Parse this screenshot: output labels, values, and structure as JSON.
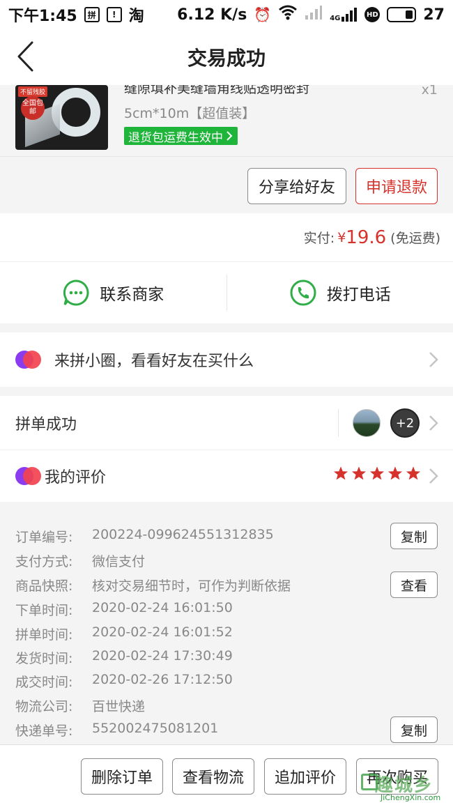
{
  "status_bar": {
    "time": "下午1:45",
    "icon_pdd": "拼",
    "icon_taobao": "淘",
    "net_speed": "6.12 K/s",
    "net_4g": "4G",
    "battery": "27"
  },
  "nav": {
    "title": "交易成功"
  },
  "product": {
    "title": "缝隙填补美缝墙角线贴透明密封",
    "quantity": "x1",
    "spec": "5cm*10m【超值装】",
    "policy_tag": "退货包运费生效中",
    "thumb_tag": "不留残胶",
    "thumb_badge": "全国包邮"
  },
  "actions": {
    "share_label": "分享给好友",
    "refund_label": "申请退款"
  },
  "payment": {
    "label": "实付:",
    "currency": "¥",
    "amount": "19.6",
    "note": "(免运费)"
  },
  "contact": {
    "merchant_label": "联系商家",
    "phone_label": "拨打电话"
  },
  "circle": {
    "text": "来拼小圈，看看好友在买什么"
  },
  "group": {
    "label": "拼单成功",
    "extra_count": "+2"
  },
  "review": {
    "label": "我的评价",
    "rating": 5,
    "max": 5
  },
  "details": {
    "order_no": {
      "key": "订单编号:",
      "value": "200224-099624551312835",
      "copy_label": "复制"
    },
    "pay_method": {
      "key": "支付方式:",
      "value": "微信支付"
    },
    "snapshot": {
      "key": "商品快照:",
      "value": "核对交易细节时，可作为判断依据",
      "view_label": "查看"
    },
    "order_time": {
      "key": "下单时间:",
      "value": "2020-02-24 16:01:50"
    },
    "group_time": {
      "key": "拼单时间:",
      "value": "2020-02-24 16:01:52"
    },
    "ship_time": {
      "key": "发货时间:",
      "value": "2020-02-24 17:30:49"
    },
    "deal_time": {
      "key": "成交时间:",
      "value": "2020-02-26 17:12:50"
    },
    "courier": {
      "key": "物流公司:",
      "value": "百世快递"
    },
    "tracking": {
      "key": "快递单号:",
      "value": "552002475081201",
      "copy_label": "复制"
    }
  },
  "bottom": {
    "delete_label": "删除订单",
    "logistics_label": "查看物流",
    "add_review_label": "追加评价",
    "rebuy_label": "再次购买"
  },
  "watermark": {
    "main": "趣城乡",
    "sub": "JiChengXin.com"
  },
  "colors": {
    "accent_red": "#d6322c",
    "green_tag": "#1fb43a",
    "icon_green": "#2fae47",
    "background": "#f4f4f4"
  }
}
